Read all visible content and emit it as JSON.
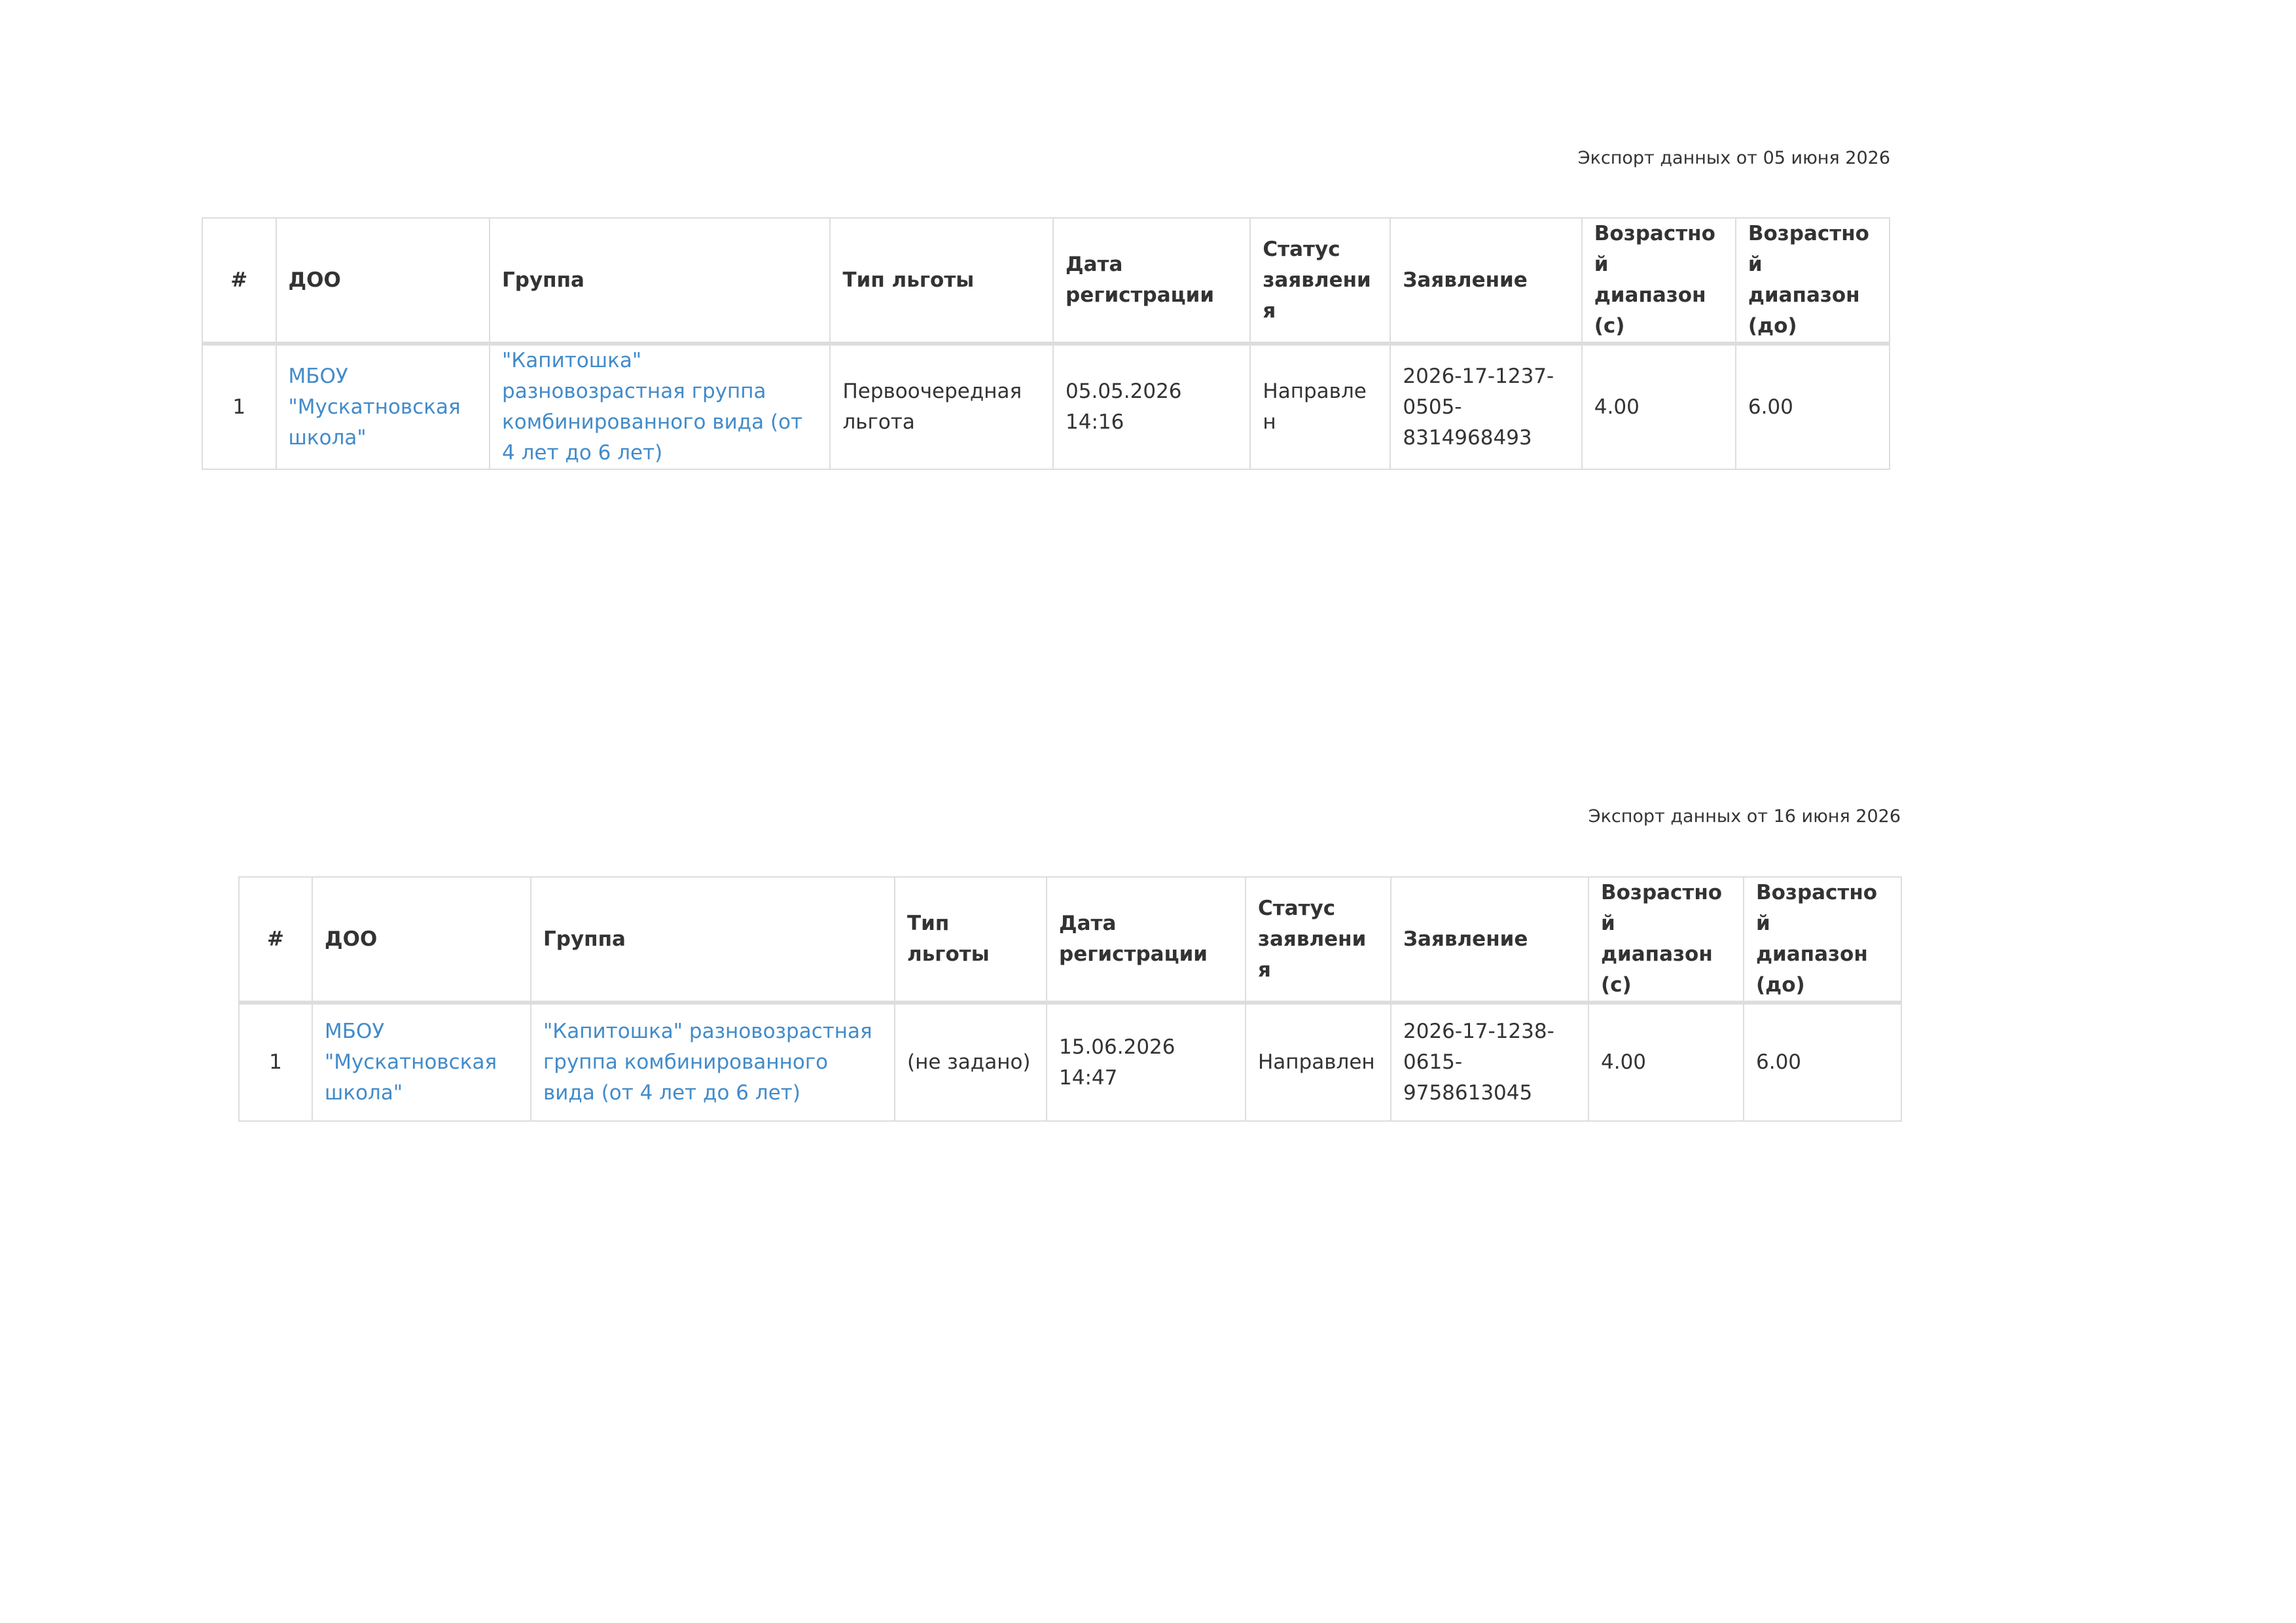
{
  "exports": [
    {
      "caption": "Экспорт данных от 05 июня 2026",
      "columns": [
        "#",
        "ДОО",
        "Группа",
        "Тип льготы",
        "Дата регистрации",
        "Статус заявления",
        "Заявление",
        "Возрастной диапазон (с)",
        "Возрастной диапазон (до)"
      ],
      "rows": [
        {
          "num": "1",
          "doo": "МБОУ \"Мускатновская школа\"",
          "group": "\"Капитошка\" разновозрастная группа комбинированного вида (от 4 лет до 6 лет)",
          "benefit": "Первоочередная льгота",
          "reg_date": "05.05.2026 14:16",
          "status": "Направлен",
          "application": "2026-17-1237-0505-8314968493",
          "age_from": "4.00",
          "age_to": "6.00"
        }
      ]
    },
    {
      "caption": "Экспорт данных от 16 июня 2026",
      "columns": [
        "#",
        "ДОО",
        "Группа",
        "Тип льготы",
        "Дата регистрации",
        "Статус заявления",
        "Заявление",
        "Возрастной диапазон (с)",
        "Возрастной диапазон (до)"
      ],
      "rows": [
        {
          "num": "1",
          "doo": "МБОУ \"Мускатновская школа\"",
          "group": "\"Капитошка\" разновозрастная группа комбинированного вида (от 4 лет до 6 лет)",
          "benefit": "(не задано)",
          "reg_date": "15.06.2026 14:47",
          "status": "Направлен",
          "application": "2026-17-1238-0615-9758613045",
          "age_from": "4.00",
          "age_to": "6.00"
        }
      ]
    }
  ],
  "colors": {
    "link": "#428bca",
    "text": "#333333",
    "border": "#dddddd"
  }
}
